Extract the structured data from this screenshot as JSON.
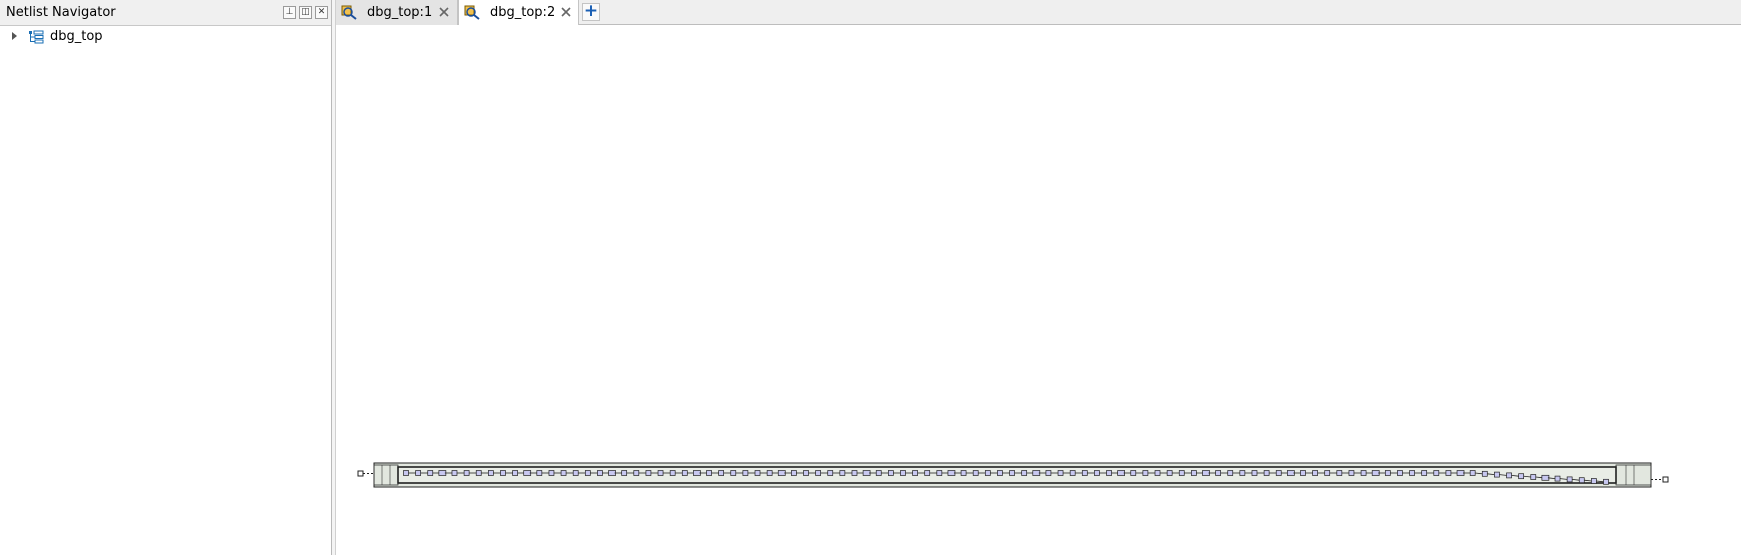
{
  "netlist_navigator": {
    "title": "Netlist Navigator",
    "buttons": [
      {
        "name": "pin-icon",
        "glyph": "⊥"
      },
      {
        "name": "restore-icon",
        "glyph": "◫"
      },
      {
        "name": "close-icon",
        "glyph": "✕"
      }
    ],
    "tree": [
      {
        "label": "dbg_top",
        "expanded": false,
        "icon": "hierarchy-icon"
      }
    ]
  },
  "tabs": [
    {
      "label": "dbg_top:1",
      "active": false,
      "icon": "schematic-icon"
    },
    {
      "label": "dbg_top:2",
      "active": true,
      "icon": "schematic-icon"
    }
  ],
  "add_tab": {
    "glyph": "+"
  },
  "schematic": {
    "instance_count": 100,
    "colors": {
      "module_fill": "#e2e7df",
      "instance_fill": "#c8c8f0",
      "wire": "#202020"
    }
  }
}
